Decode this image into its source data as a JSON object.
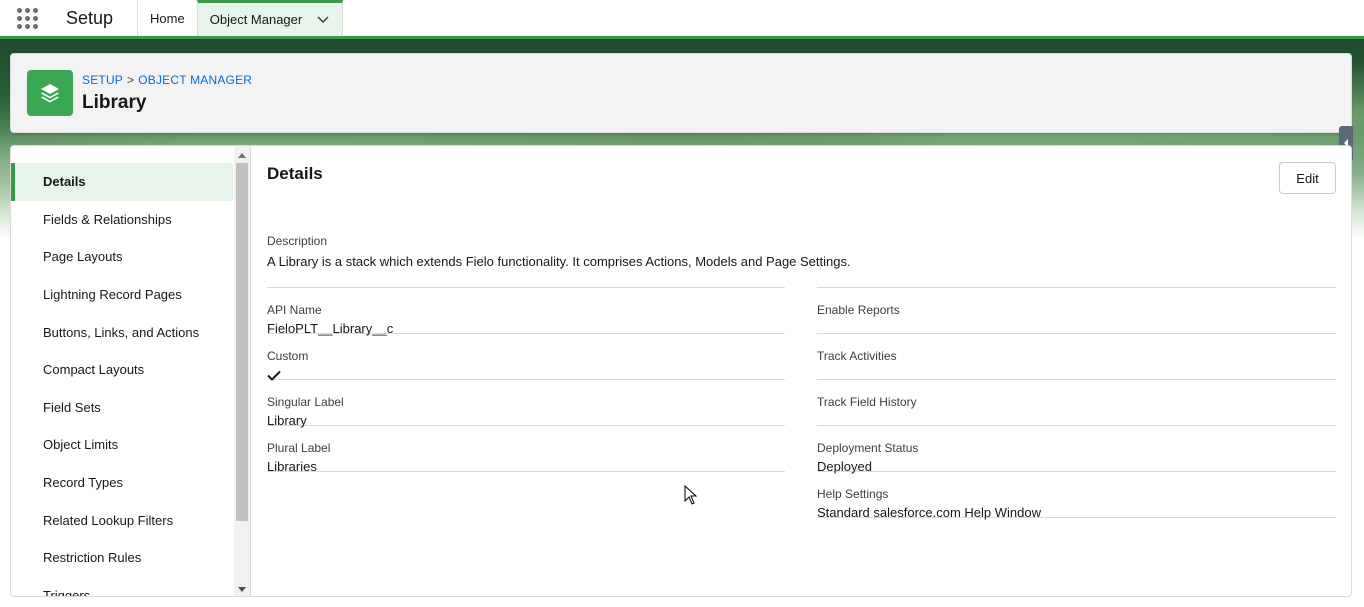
{
  "topbar": {
    "app_launcher": "app-launcher-icon",
    "app_name": "Setup",
    "tabs": [
      {
        "label": "Home",
        "active": false
      },
      {
        "label": "Object Manager",
        "active": true
      }
    ]
  },
  "header": {
    "breadcrumb": [
      "SETUP",
      "OBJECT MANAGER"
    ],
    "breadcrumb_separator": ">",
    "title": "Library",
    "icon": "layers-icon",
    "icon_color": "#3ba755"
  },
  "sidebar": {
    "items": [
      {
        "label": "Details",
        "active": true
      },
      {
        "label": "Fields & Relationships"
      },
      {
        "label": "Page Layouts"
      },
      {
        "label": "Lightning Record Pages"
      },
      {
        "label": "Buttons, Links, and Actions"
      },
      {
        "label": "Compact Layouts"
      },
      {
        "label": "Field Sets"
      },
      {
        "label": "Object Limits"
      },
      {
        "label": "Record Types"
      },
      {
        "label": "Related Lookup Filters"
      },
      {
        "label": "Restriction Rules"
      },
      {
        "label": "Triggers"
      }
    ]
  },
  "details": {
    "title": "Details",
    "edit_label": "Edit",
    "description_label": "Description",
    "description_value": "A Library is a stack which extends Fielo functionality. It comprises Actions, Models and Page Settings.",
    "left_fields": [
      {
        "label": "API Name",
        "value": "FieloPLT__Library__c"
      },
      {
        "label": "Custom",
        "value": "",
        "checked": true
      },
      {
        "label": "Singular Label",
        "value": "Library"
      },
      {
        "label": "Plural Label",
        "value": "Libraries"
      }
    ],
    "right_fields": [
      {
        "label": "Enable Reports",
        "value": ""
      },
      {
        "label": "Track Activities",
        "value": ""
      },
      {
        "label": "Track Field History",
        "value": ""
      },
      {
        "label": "Deployment Status",
        "value": "Deployed"
      },
      {
        "label": "Help Settings",
        "value": "Standard salesforce.com Help Window"
      }
    ]
  },
  "colors": {
    "accent_green": "#3b9a4a",
    "link_blue": "#0b6bcb",
    "active_bg": "#e8f4ea"
  }
}
